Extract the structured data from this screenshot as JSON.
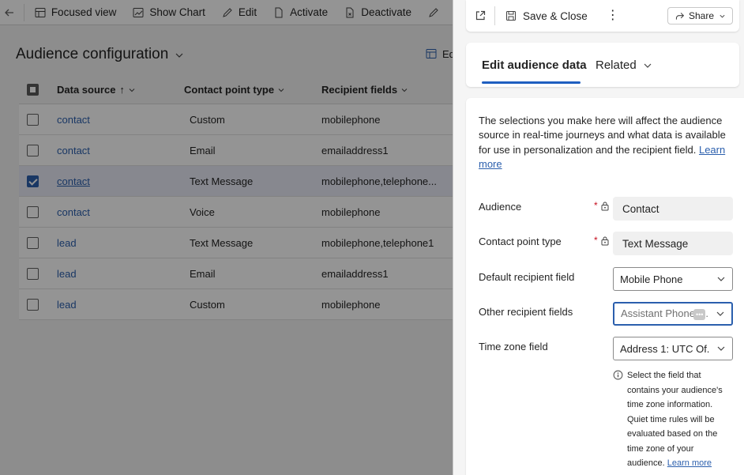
{
  "toolbar": {
    "focused_view": "Focused view",
    "show_chart": "Show Chart",
    "edit": "Edit",
    "activate": "Activate",
    "deactivate": "Deactivate"
  },
  "page": {
    "title": "Audience configuration",
    "edit_columns": "Ed"
  },
  "grid": {
    "headers": {
      "data_source": "Data source",
      "sort_indicator": "↑",
      "contact_point_type": "Contact point type",
      "recipient_fields": "Recipient fields"
    },
    "rows": [
      {
        "source": "contact",
        "type": "Custom",
        "recipient": "mobilephone",
        "selected": false
      },
      {
        "source": "contact",
        "type": "Email",
        "recipient": "emailaddress1",
        "selected": false
      },
      {
        "source": "contact",
        "type": "Text Message",
        "recipient": "mobilephone,telephone...",
        "selected": true
      },
      {
        "source": "contact",
        "type": "Voice",
        "recipient": "mobilephone",
        "selected": false
      },
      {
        "source": "lead",
        "type": "Text Message",
        "recipient": "mobilephone,telephone1",
        "selected": false
      },
      {
        "source": "lead",
        "type": "Email",
        "recipient": "emailaddress1",
        "selected": false
      },
      {
        "source": "lead",
        "type": "Custom",
        "recipient": "mobilephone",
        "selected": false
      }
    ]
  },
  "panel": {
    "save_close": "Save & Close",
    "more": "⋮",
    "share": "Share",
    "tabs": {
      "edit": "Edit audience data",
      "related": "Related"
    },
    "intro": "The selections you make here will affect the audience source in real-time journeys and what data is available for use in personalization and the recipient field.",
    "intro_link": "Learn more",
    "fields": {
      "audience_label": "Audience",
      "audience_value": "Contact",
      "cpt_label": "Contact point type",
      "cpt_value": "Text Message",
      "default_label": "Default recipient field",
      "default_value": "Mobile Phone",
      "other_label": "Other recipient fields",
      "other_value": "Assistant Phone",
      "other_overflow": "•••",
      "other_trail": ".",
      "tz_label": "Time zone field",
      "tz_value": "Address 1: UTC Of...",
      "required_mark": "*"
    },
    "tz_help": "Select the field that contains your audience's time zone information. Quiet time rules will be evaluated based on the time zone of your audience.",
    "tz_help_link": "Learn more"
  },
  "colors": {
    "accent": "#2b5fad",
    "tab_underline": "#1f5fc0",
    "required": "#c50f1f"
  }
}
